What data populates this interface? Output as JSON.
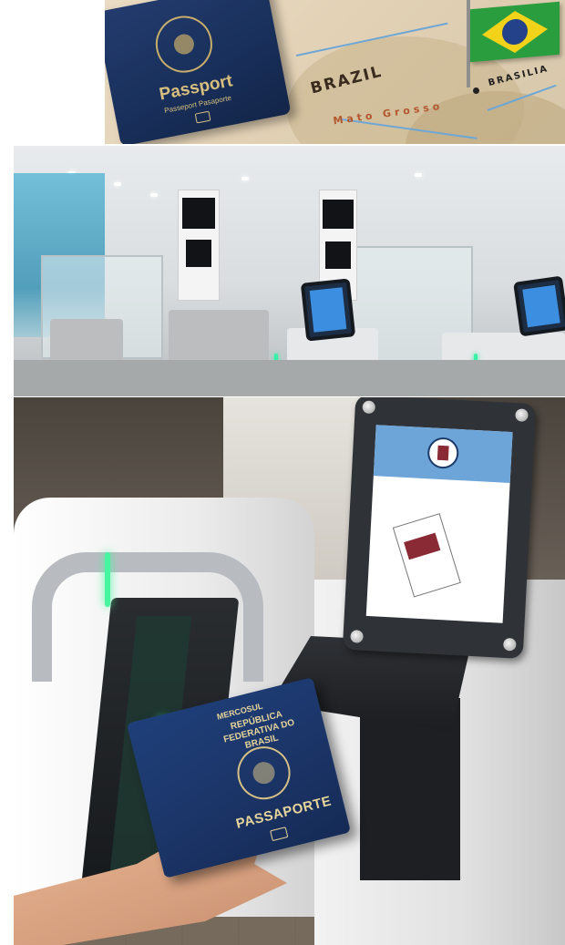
{
  "top_image": {
    "passport_title": "Passport",
    "passport_subtitle": "Passeport Pasaporte",
    "map_labels": {
      "country": "BRAZIL",
      "capital": "BRASILIA",
      "region": "Mato Grosso"
    }
  },
  "bottom_image": {
    "passport_cover": {
      "bloc": "MERCOSUL",
      "country": "REPÚBLICA FEDERATIVA DO BRASIL",
      "document": "PASSAPORTE"
    }
  },
  "colors": {
    "flag_green": "#2a9d3e",
    "flag_yellow": "#f3d21a",
    "flag_blue": "#24428a",
    "passport_blue": "#1b3466",
    "gate_light_green": "#47f5a0",
    "kiosk_screen_blue": "#3c8fe0"
  }
}
